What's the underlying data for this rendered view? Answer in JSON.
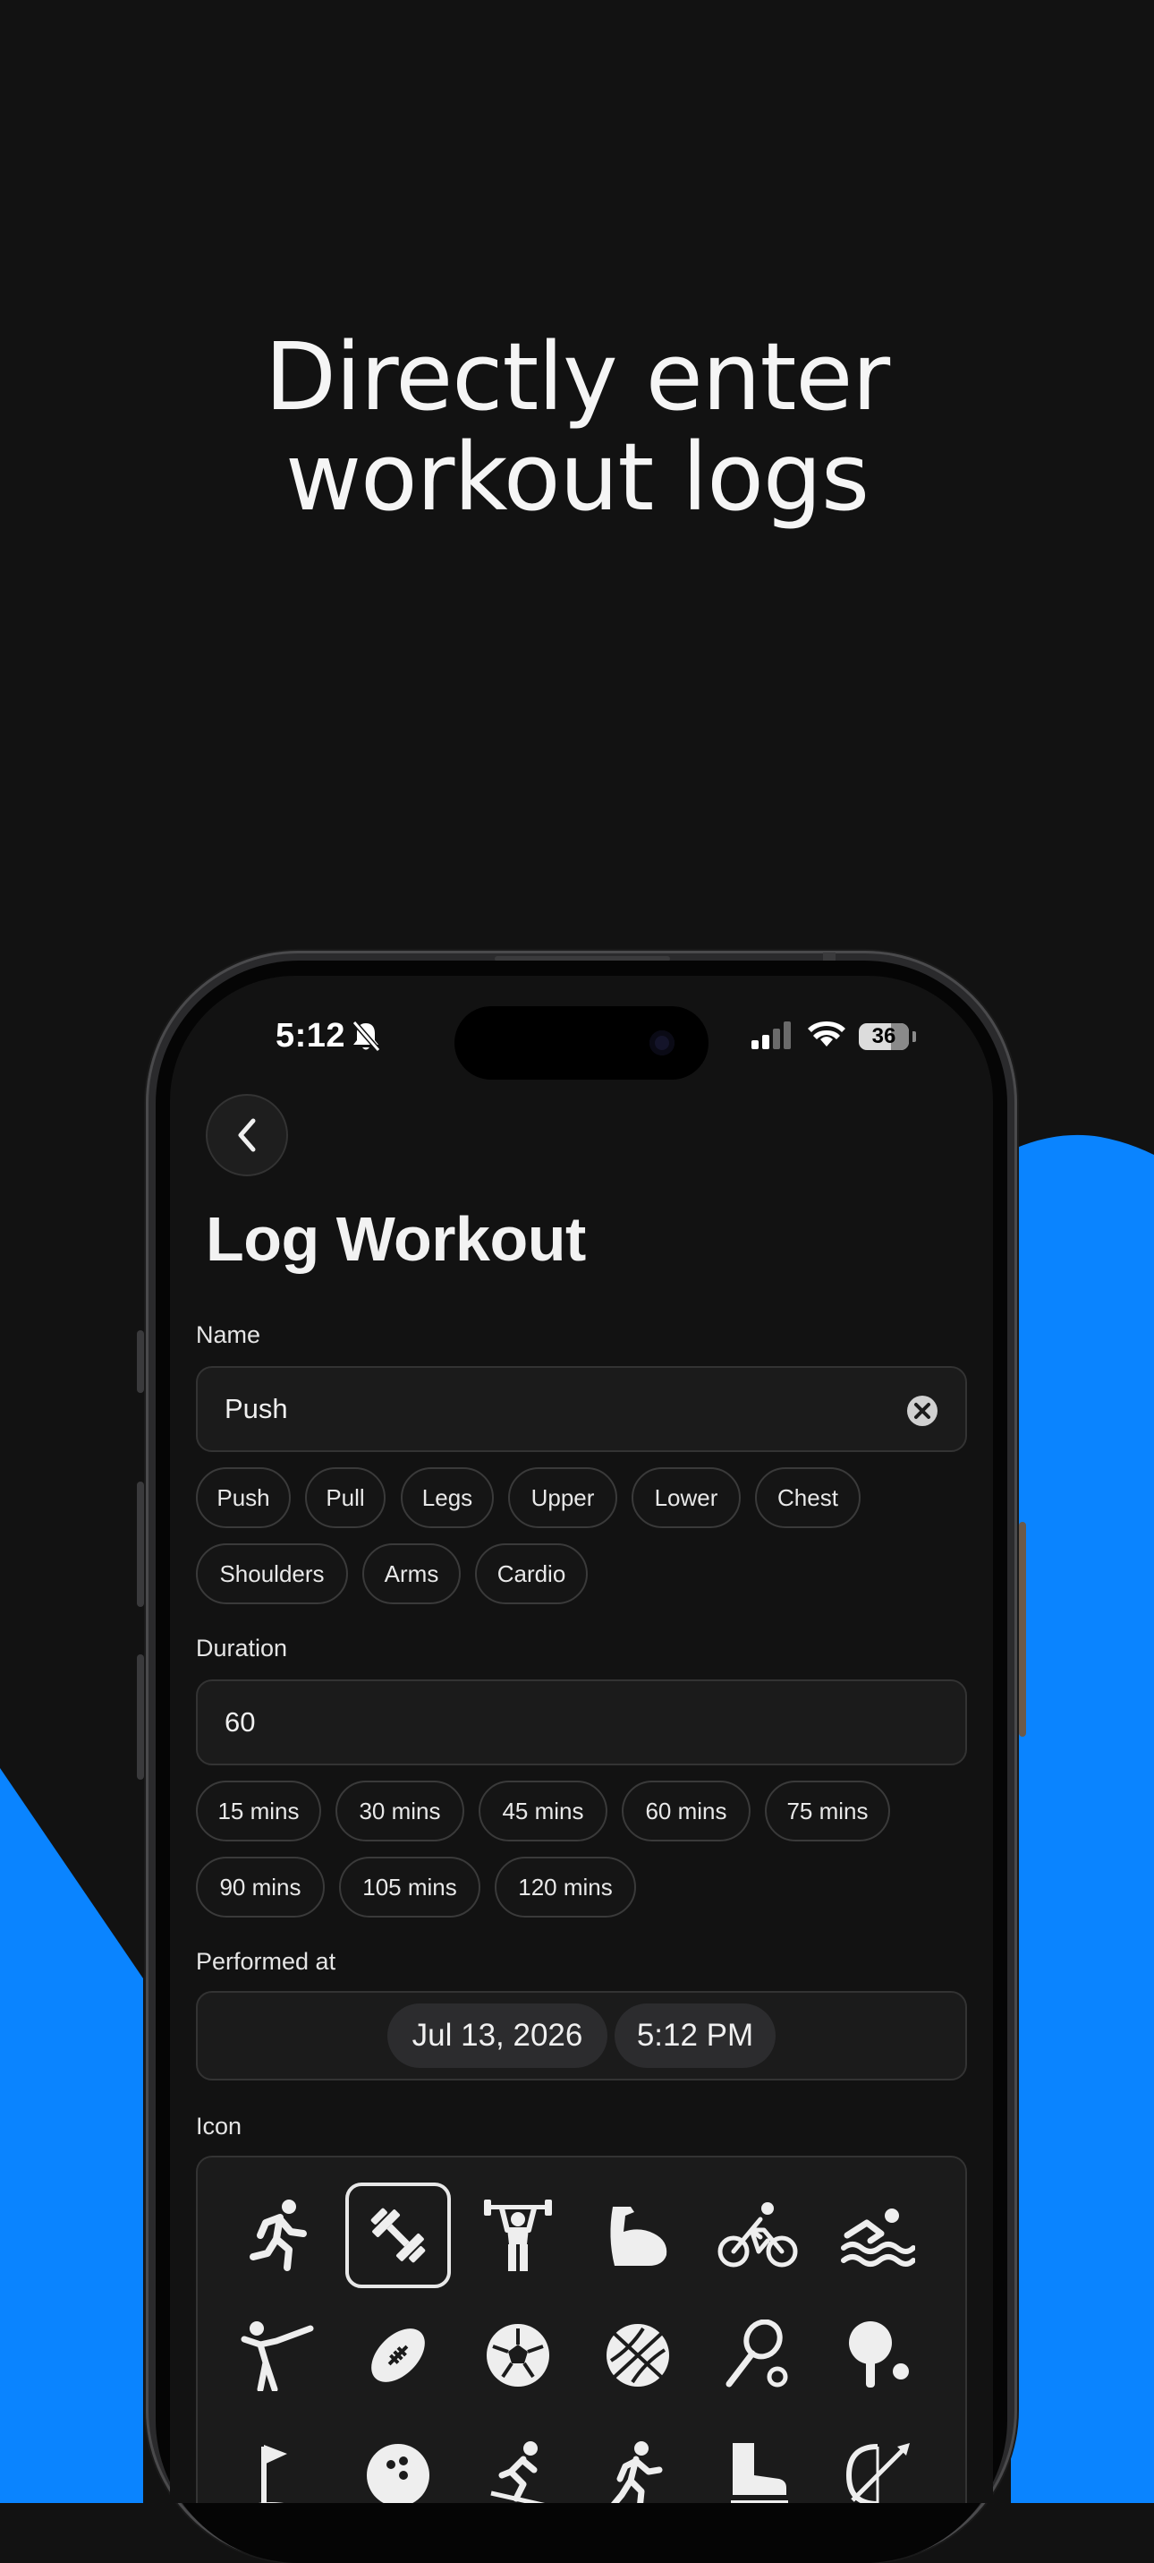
{
  "headline": {
    "line1": "Directly enter",
    "line2": "workout logs"
  },
  "colors": {
    "background": "#121212",
    "accent_blue": "#0a84ff",
    "surface": "#1b1b1b",
    "chip_border": "#3a3a3a"
  },
  "status_bar": {
    "time": "5:12",
    "battery": "36",
    "icons": [
      "bell-slash-icon",
      "cellular-signal-icon",
      "wifi-icon",
      "battery-icon"
    ]
  },
  "screen": {
    "title": "Log Workout",
    "name": {
      "label": "Name",
      "value": "Push",
      "suggestions": [
        "Push",
        "Pull",
        "Legs",
        "Upper",
        "Lower",
        "Chest",
        "Shoulders",
        "Arms",
        "Cardio"
      ]
    },
    "duration": {
      "label": "Duration",
      "value": "60",
      "suggestions": [
        "15 mins",
        "30 mins",
        "45 mins",
        "60 mins",
        "75 mins",
        "90 mins",
        "105 mins",
        "120 mins"
      ]
    },
    "performed_at": {
      "label": "Performed at",
      "date": "Jul 13, 2026",
      "time": "5:12 PM"
    },
    "icon": {
      "label": "Icon",
      "selected": "weights-icon",
      "icons": [
        "running-icon",
        "weights-icon",
        "weightlifting-icon",
        "bicep-icon",
        "cycling-icon",
        "swimming-icon",
        "martial-arts-icon",
        "football-icon",
        "soccer-ball-icon",
        "basketball-icon",
        "tennis-icon",
        "ping-pong-icon",
        "golf-icon",
        "bowling-icon",
        "skiing-icon",
        "hiking-icon",
        "skating-icon",
        "archery-icon"
      ]
    }
  }
}
